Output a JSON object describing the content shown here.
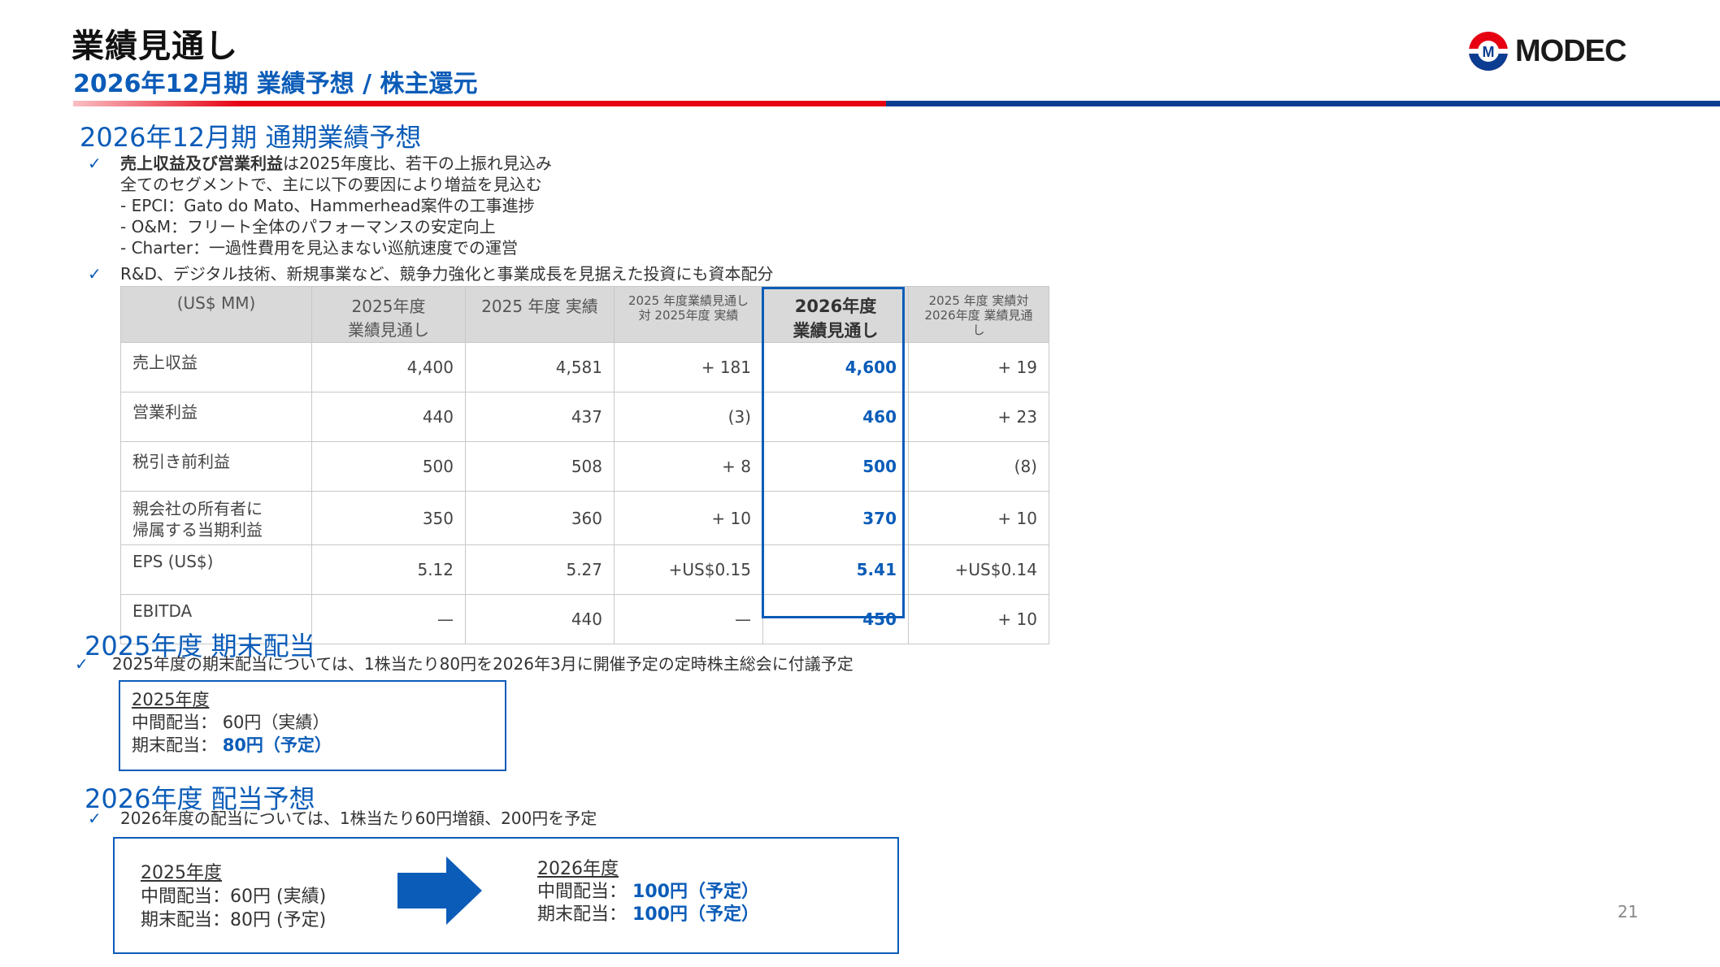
{
  "header": {
    "title": "業績見通し",
    "subtitle": "2026年12月期 業績予想 / 株主還元",
    "logo_text": "MODEC"
  },
  "forecast": {
    "heading": "2026年12月期 通期業績予想",
    "bullet1_bold": "売上収益及び営業利益",
    "bullet1_rest": "は2025年度比、若干の上振れ見込み",
    "bullet1_lines": [
      "全てのセグメントで、主に以下の要因により増益を見込む",
      "- EPCI：Gato do Mato、Hammerhead案件の工事進捗",
      "- O&M：フリート全体のパフォーマンスの安定向上",
      "- Charter：一過性費用を見込まない巡航速度での運営"
    ],
    "bullet2": "R&D、デジタル技術、新規事業など、競争力強化と事業成長を見据えた投資にも資本配分"
  },
  "table": {
    "headers": {
      "unit": "(US$ MM)",
      "col1": "2025年度\n業績見通し",
      "col2": "2025 年度 実績",
      "col3": "2025 年度業績見通し\n対 2025年度 実績",
      "col4": "2026年度\n業績見通し",
      "col5": "2025 年度 実績対\n2026年度 業績見通し"
    },
    "rows": [
      {
        "label": "売上収益",
        "c1": "4,400",
        "c2": "4,581",
        "c3": "+ 181",
        "c4": "4,600",
        "c5": "+ 19"
      },
      {
        "label": "営業利益",
        "c1": "440",
        "c2": "437",
        "c3": "(3)",
        "c4": "460",
        "c5": "+ 23"
      },
      {
        "label": "税引き前利益",
        "c1": "500",
        "c2": "508",
        "c3": "+ 8",
        "c4": "500",
        "c5": "(8)"
      },
      {
        "label": "親会社の所有者に\n帰属する当期利益",
        "c1": "350",
        "c2": "360",
        "c3": "+ 10",
        "c4": "370",
        "c5": "+ 10"
      },
      {
        "label": "EPS (US$)",
        "c1": "5.12",
        "c2": "5.27",
        "c3": "+US$0.15",
        "c4": "5.41",
        "c5": "+US$0.14"
      },
      {
        "label": "EBITDA",
        "c1": "—",
        "c2": "440",
        "c3": "—",
        "c4": "450",
        "c5": "+ 10"
      }
    ]
  },
  "dividend2025": {
    "heading": "2025年度 期末配当",
    "bullet": "2025年度の期末配当については、1株当たり80円を2026年3月に開催予定の定時株主総会に付議予定",
    "box_title": "2025年度",
    "interim_label": "中間配当：",
    "interim_value": "60円（実績）",
    "final_label": "期末配当：",
    "final_value": "80円（予定）"
  },
  "dividend2026": {
    "heading": "2026年度 配当予想",
    "bullet": "2026年度の配当については、1株当たり60円増額、200円を予定",
    "left_title": "2025年度",
    "left_interim": "中間配当：60円 (実績)",
    "left_final": "期末配当：80円 (予定)",
    "right_title": "2026年度",
    "right_interim_label": "中間配当：",
    "right_interim_value": "100円（予定）",
    "right_final_label": "期末配当：",
    "right_final_value": "100円（予定）"
  },
  "page_number": "21",
  "colors": {
    "accent_blue": "#0b5cb8",
    "red": "#e60012",
    "navy": "#0b3d91"
  }
}
